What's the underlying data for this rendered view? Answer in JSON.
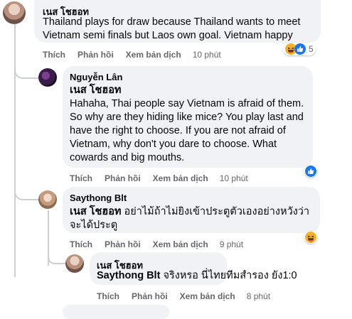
{
  "comments": [
    {
      "author": "เนส โชฮอท",
      "text": "Thailand plays for draw because Thailand wants to meet Vietnam semi finals but Laos own goal. Vietnam happy",
      "actions": {
        "like": "Thích",
        "reply": "Phản hồi",
        "translate": "Xem bản dịch",
        "time": "10 phút"
      },
      "reactions": {
        "count": "5",
        "icons": [
          "haha-icon",
          "like-icon"
        ]
      }
    },
    {
      "author": "Nguyễn Lân",
      "mention": "เนส โชฮอท",
      "text": "Hahaha, Thai people say Vietnam is afraid of them. So why are they hiding like mice? You play last and have the right to choose. If you are not afraid of Vietnam, why don't you dare to choose. What cowards and big mouths.",
      "actions": {
        "like": "Thích",
        "reply": "Phản hồi",
        "translate": "Xem bản dịch",
        "time": "10 phút"
      },
      "reactions": {
        "icons": [
          "like-icon"
        ]
      }
    },
    {
      "author": "Saythong Blt",
      "mention": "เนส โชฮอท",
      "text": "อย่าไม้ถ้าไม่ยิงเข้าประตูตัวเองอย่างหวังว่าจะได้ประตู",
      "actions": {
        "like": "Thích",
        "reply": "Phản hồi",
        "translate": "Xem bản dịch",
        "time": "9 phút"
      },
      "reactions": {
        "icons": [
          "haha-icon"
        ]
      }
    },
    {
      "author": "เนส โชฮอท",
      "mention": "Saythong Blt",
      "text": "จริงหรอ นี่ไทยทีมสำรอง ยัง1:0",
      "actions": {
        "like": "Thích",
        "reply": "Phản hồi",
        "translate": "Xem bản dịch",
        "time": "8 phút"
      }
    }
  ],
  "colors": {
    "bubble": "#f0f2f5",
    "text": "#050505",
    "meta": "#65676b",
    "like_blue": "#1877f2",
    "haha_yellow": "#f7b125"
  }
}
